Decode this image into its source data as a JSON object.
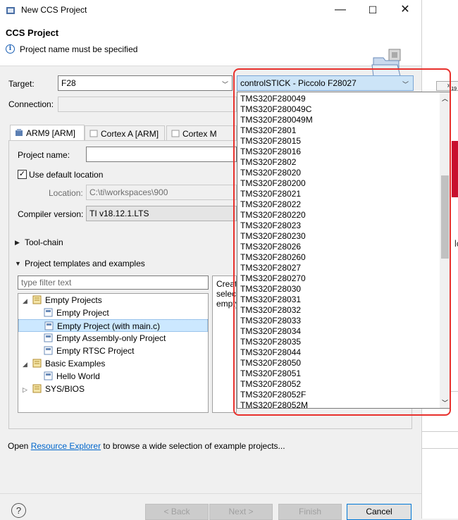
{
  "window": {
    "title": "New CCS Project",
    "minimize": "—",
    "maximize": "☐",
    "close": "✕"
  },
  "header": {
    "title": "CCS Project",
    "message": "Project name must be specified"
  },
  "target": {
    "label": "Target:",
    "filter_value": "F28",
    "device_selected": "controlSTICK - Piccolo F28027",
    "device_options": [
      "TMS320F280049",
      "TMS320F280049C",
      "TMS320F280049M",
      "TMS320F2801",
      "TMS320F28015",
      "TMS320F28016",
      "TMS320F2802",
      "TMS320F28020",
      "TMS320F280200",
      "TMS320F28021",
      "TMS320F28022",
      "TMS320F280220",
      "TMS320F28023",
      "TMS320F280230",
      "TMS320F28026",
      "TMS320F280260",
      "TMS320F28027",
      "TMS320F280270",
      "TMS320F28030",
      "TMS320F28031",
      "TMS320F28032",
      "TMS320F28033",
      "TMS320F28034",
      "TMS320F28035",
      "TMS320F28044",
      "TMS320F28050",
      "TMS320F28051",
      "TMS320F28052",
      "TMS320F28052F",
      "TMS320F28052M"
    ]
  },
  "connection": {
    "label": "Connection:"
  },
  "tabs": [
    "ARM9 [ARM]",
    "Cortex A [ARM]",
    "Cortex M [ARM"
  ],
  "project": {
    "name_label": "Project name:",
    "name_value": "",
    "use_default_label": "Use default location",
    "use_default_checked": true,
    "location_label": "Location:",
    "location_value": "C:\\ti\\workspaces\\900",
    "compiler_label": "Compiler version:",
    "compiler_value": "TI v18.12.1.LTS"
  },
  "sections": {
    "toolchain": "Tool-chain",
    "templates": "Project templates and examples"
  },
  "templates": {
    "filter_placeholder": "type filter text",
    "tree": [
      {
        "label": "Empty Projects",
        "level": 0,
        "expanded": true
      },
      {
        "label": "Empty Project",
        "level": 1
      },
      {
        "label": "Empty Project (with main.c)",
        "level": 1,
        "selected": true
      },
      {
        "label": "Empty Assembly-only Project",
        "level": 1
      },
      {
        "label": "Empty RTSC Project",
        "level": 1
      },
      {
        "label": "Basic Examples",
        "level": 0,
        "expanded": true
      },
      {
        "label": "Hello World",
        "level": 1
      },
      {
        "label": "SYS/BIOS",
        "level": 0,
        "expanded": false
      }
    ],
    "description_lines": [
      "Create",
      "select",
      "empty"
    ]
  },
  "footer": {
    "open_text": "Open",
    "link_text": "Resource Explorer",
    "rest_text": "to browse a wide selection of example projects...",
    "help": "?",
    "back": "< Back",
    "next": "Next >",
    "finish": "Finish",
    "cancel": "Cancel"
  },
  "background": {
    "number_fragment": "19"
  },
  "colors": {
    "accent": "#0078d7",
    "highlight": "#e8302c",
    "selection": "#cce8ff"
  }
}
